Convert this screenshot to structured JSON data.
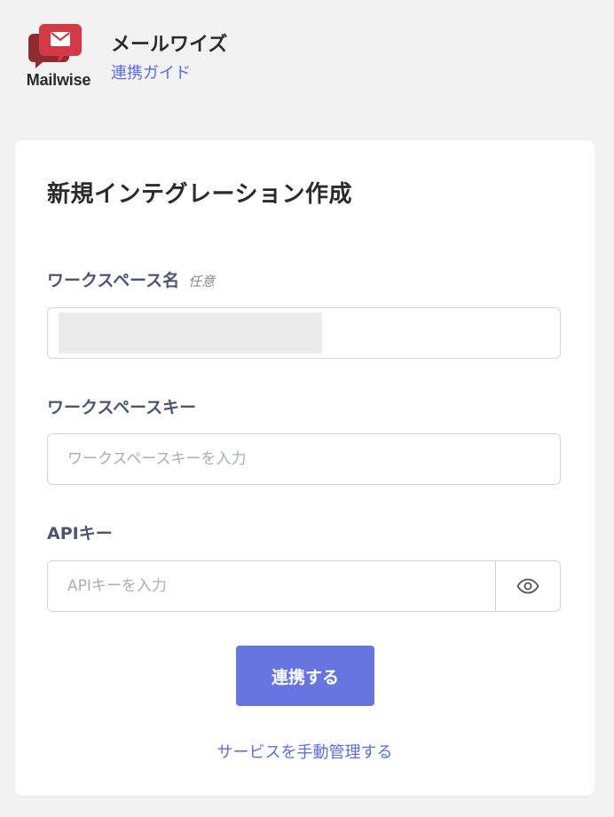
{
  "header": {
    "logo_text": "Mailwise",
    "app_name": "メールワイズ",
    "guide_link": "連携ガイド"
  },
  "form": {
    "title": "新規インテグレーション作成",
    "workspace_name": {
      "label": "ワークスペース名",
      "optional": "任意",
      "value": ""
    },
    "workspace_key": {
      "label": "ワークスペースキー",
      "placeholder": "ワークスペースキーを入力",
      "value": ""
    },
    "api_key": {
      "label": "APIキー",
      "placeholder": "APIキーを入力",
      "value": "",
      "toggle_icon": "eye-icon"
    },
    "submit_label": "連携する",
    "manage_link": "サービスを手動管理する"
  },
  "colors": {
    "accent": "#6675e0",
    "link": "#5b6ee1",
    "logo_red": "#c8363f",
    "background": "#f2f2f2"
  }
}
